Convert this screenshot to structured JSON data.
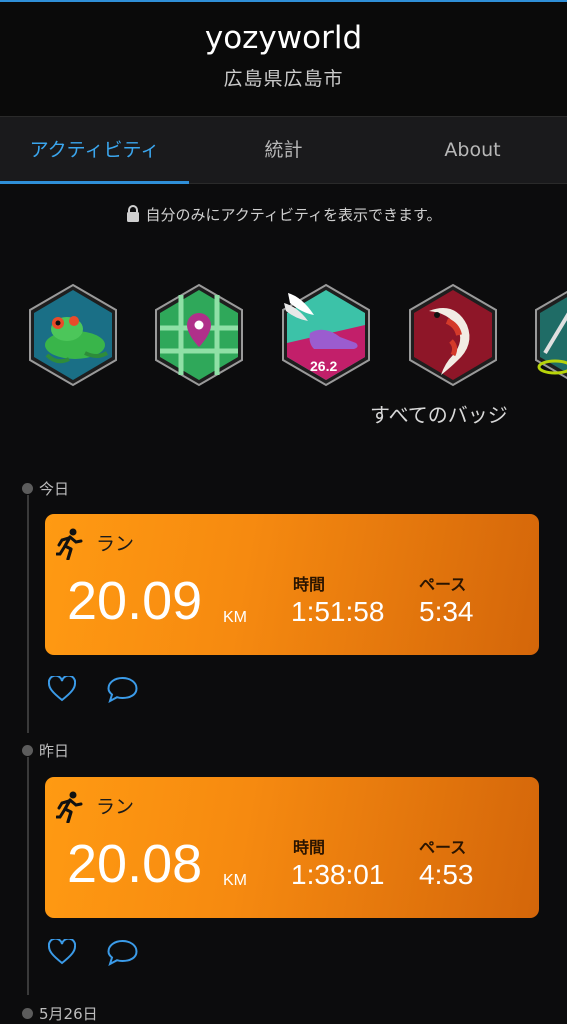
{
  "profile": {
    "name": "yozyworld",
    "location": "広島県広島市"
  },
  "tabs": [
    {
      "label": "アクティビティ",
      "active": true
    },
    {
      "label": "統計",
      "active": false
    },
    {
      "label": "About",
      "active": false
    }
  ],
  "privacy_notice": "自分のみにアクティビティを表示できます。",
  "badges": {
    "items": [
      {
        "icon": "frog-badge-icon"
      },
      {
        "icon": "map-pin-badge-icon"
      },
      {
        "icon": "marathon-shoe-badge-icon",
        "text": "26.2"
      },
      {
        "icon": "koi-fish-badge-icon"
      },
      {
        "icon": "partial-badge-icon"
      }
    ],
    "all_label": "すべてのバッジ"
  },
  "feed": [
    {
      "date": "今日",
      "type": "ラン",
      "distance": "20.09",
      "unit": "KM",
      "time_label": "時間",
      "time": "1:51:58",
      "pace_label": "ペース",
      "pace": "5:34"
    },
    {
      "date": "昨日",
      "type": "ラン",
      "distance": "20.08",
      "unit": "KM",
      "time_label": "時間",
      "time": "1:38:01",
      "pace_label": "ペース",
      "pace": "4:53"
    },
    {
      "date": "5月26日"
    }
  ],
  "colors": {
    "accent": "#2f8fd8",
    "card_orange": "#f68a10",
    "background": "#0c0c0d"
  }
}
